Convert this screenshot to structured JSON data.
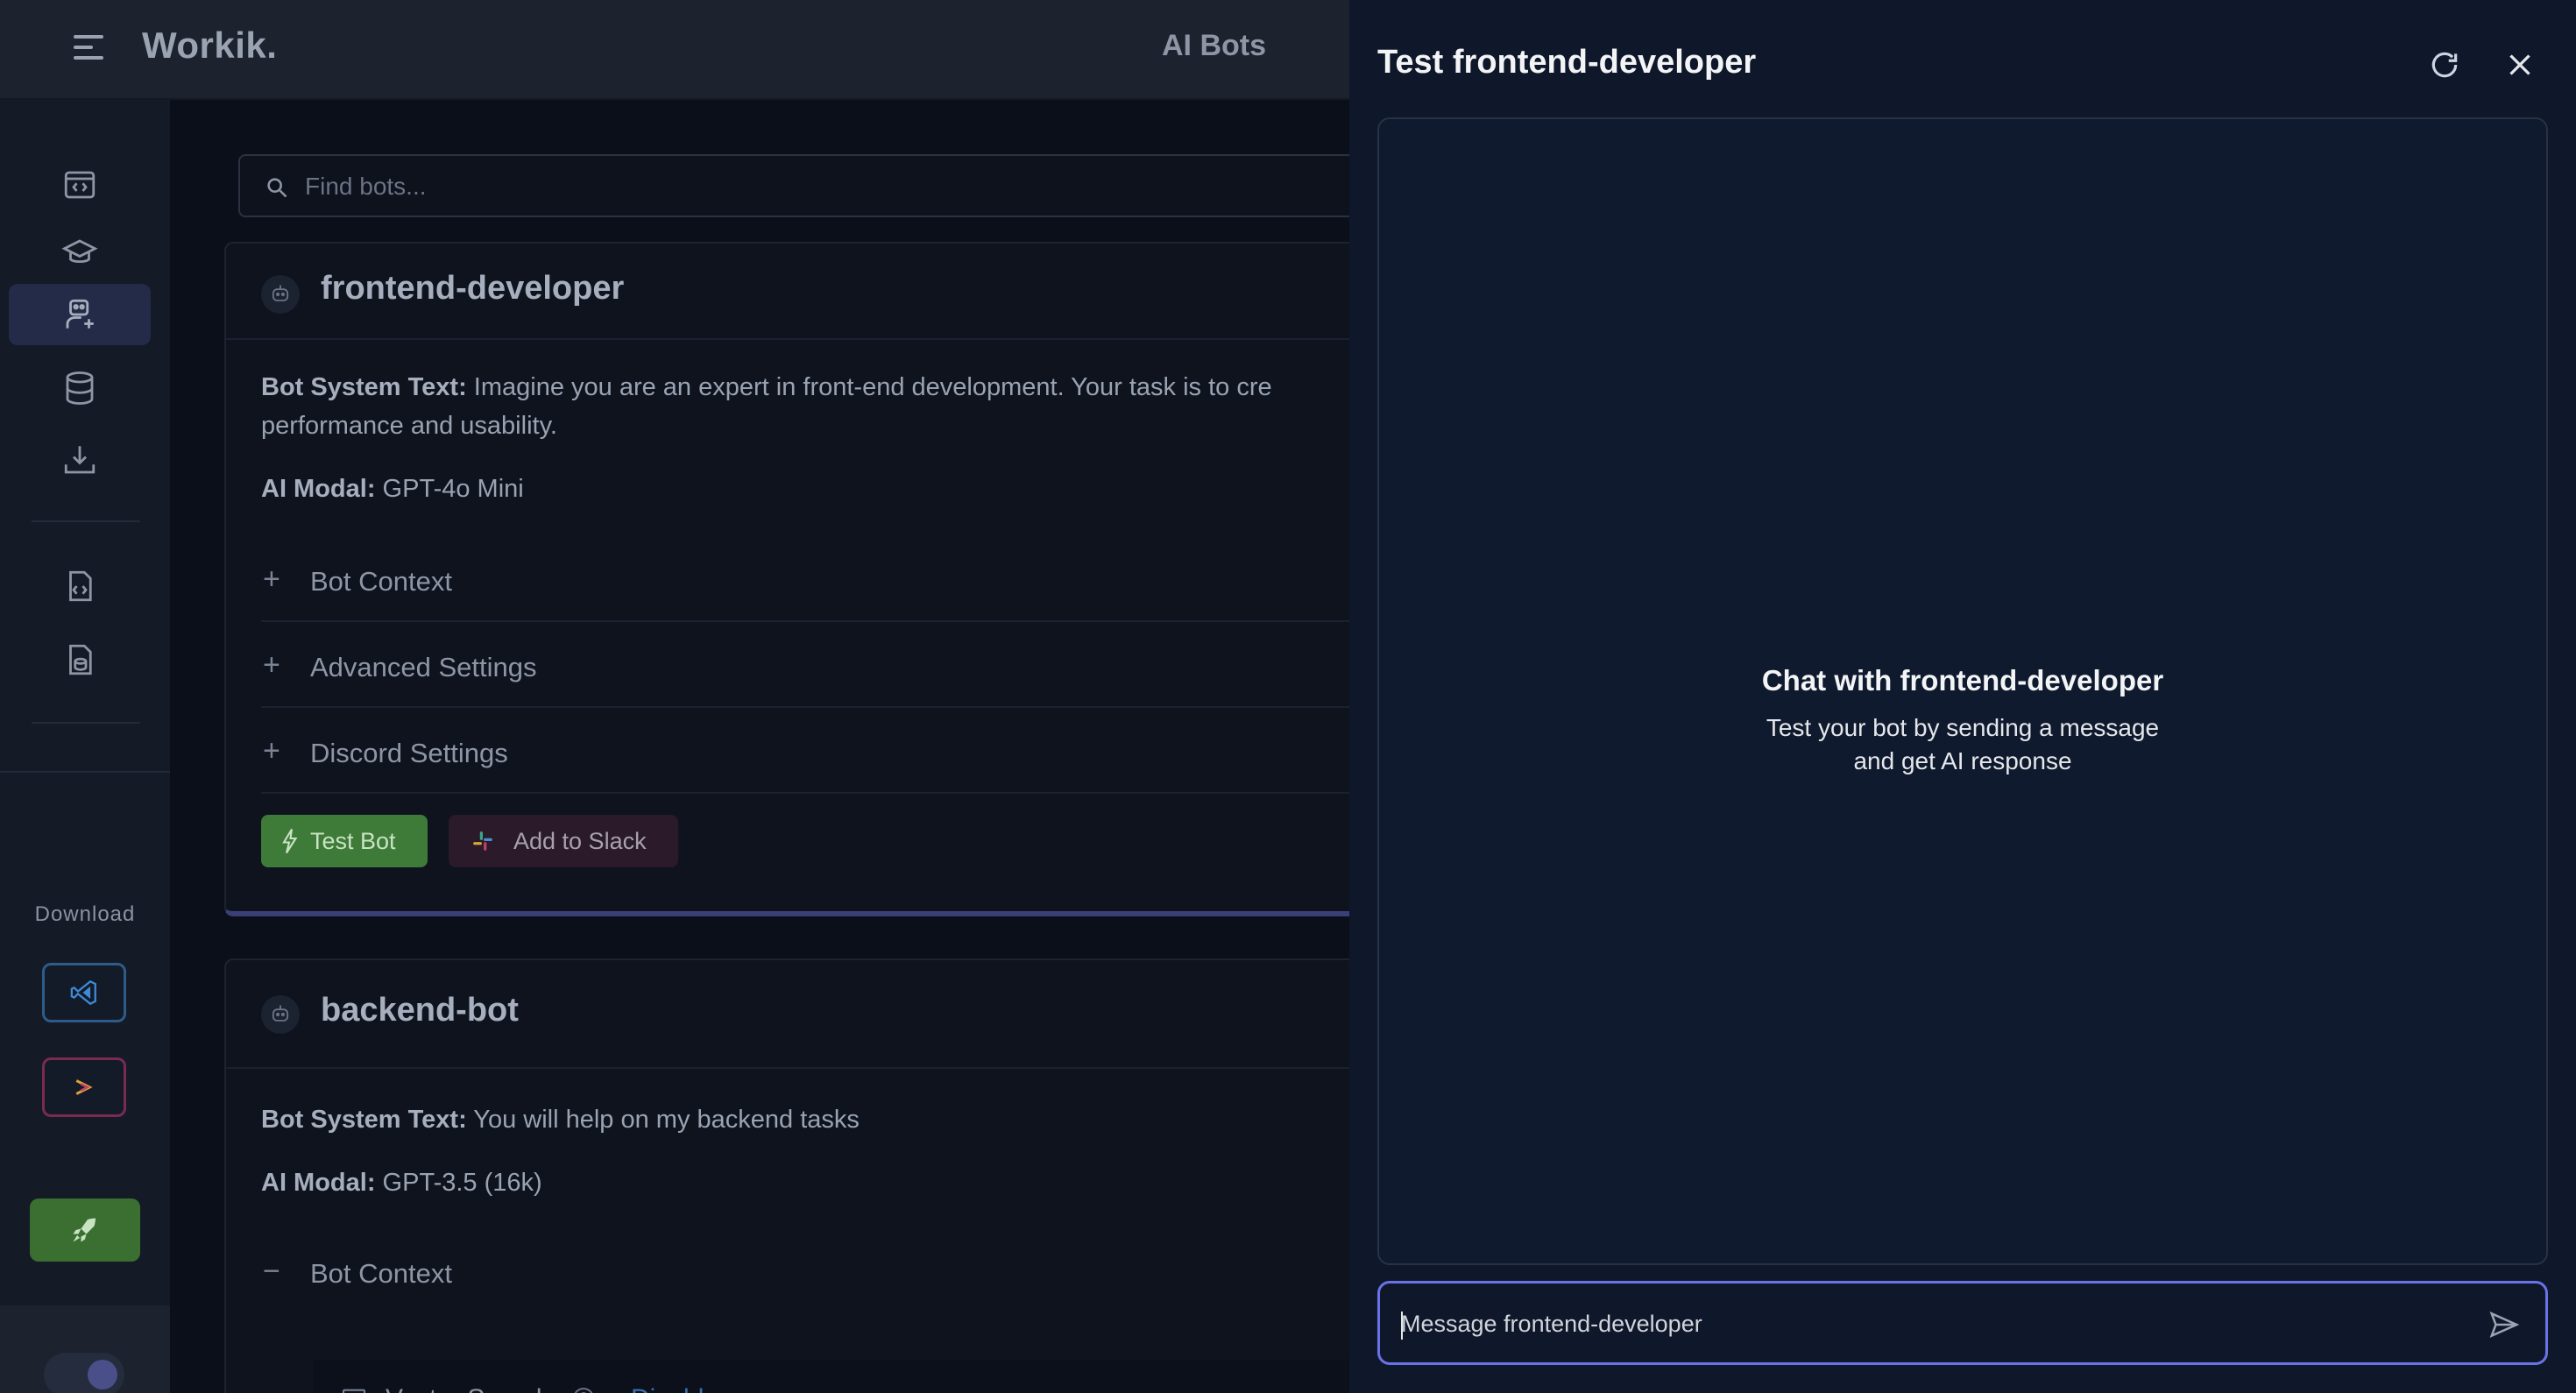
{
  "app": {
    "brand": "Workik.",
    "page_title": "AI Bots"
  },
  "sidebar": {
    "items": [
      {
        "icon": "code-window-icon"
      },
      {
        "icon": "graduation-cap-icon"
      },
      {
        "icon": "bot-user-icon",
        "active": true
      },
      {
        "icon": "database-icon"
      },
      {
        "icon": "download-tray-icon"
      },
      {
        "icon": "code-file-icon"
      },
      {
        "icon": "file-db-icon"
      },
      {
        "icon": "link-icon"
      }
    ],
    "download_label": "Download",
    "download_buttons": [
      "vscode-icon",
      "jetbrains-icon"
    ],
    "rocket": "rocket-icon"
  },
  "search": {
    "placeholder": "Find bots..."
  },
  "bots": [
    {
      "name": "frontend-developer",
      "system_text_label": "Bot System Text:",
      "system_text": " Imagine you are an expert in front-end development. Your task is to cre",
      "system_text_line2": "performance and usability.",
      "model_label": "AI Modal:",
      "model": " GPT-4o Mini",
      "sections": [
        "Bot Context",
        "Advanced Settings",
        "Discord Settings"
      ],
      "test_button": "Test Bot",
      "slack_button": "Add to Slack"
    },
    {
      "name": "backend-bot",
      "system_text_label": "Bot System Text:",
      "system_text": " You will help on my backend tasks",
      "model_label": "AI Modal:",
      "model": " GPT-3.5 (16k)",
      "context_label": "Bot Context",
      "vector_search_label": "Vector Search",
      "vector_search_sep": ":",
      "vector_search_action": "Disable"
    }
  ],
  "panel": {
    "title": "Test frontend-developer",
    "empty_title": "Chat with frontend-developer",
    "empty_subtitle": "Test your bot by sending a message and get AI response",
    "message_placeholder": "Message frontend-developer"
  },
  "colors": {
    "accent": "#6a73e6",
    "test_button": "#3e7a38",
    "link": "#3c6fb0"
  }
}
